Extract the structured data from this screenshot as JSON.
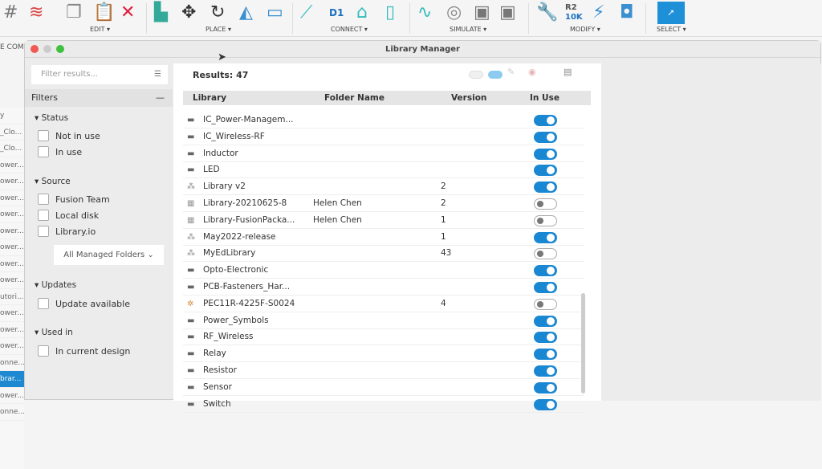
{
  "toolbar": {
    "groups": [
      "EDIT ▾",
      "PLACE ▾",
      "CONNECT ▾",
      "SIMULATE ▾",
      "MODIFY ▾",
      "SELECT ▾"
    ],
    "r2_label": "R2",
    "r2_value": "10K",
    "d1": "D1",
    "comp": "E COMP"
  },
  "background_list": [
    "y",
    "_Clo...",
    "_Clo...",
    "ower...",
    "ower...",
    "ower...",
    "ower...",
    "ower...",
    "ower...",
    "ower...",
    "ower...",
    "utori...",
    "ower...",
    "ower...",
    "ower...",
    "onne...",
    "brar...",
    "ower...",
    "onne..."
  ],
  "dialog": {
    "title": "Library Manager"
  },
  "filters": {
    "search_placeholder": "Filter results...",
    "title": "Filters",
    "collapse": "—",
    "status": "Status",
    "not_in_use": "Not in use",
    "in_use": "In use",
    "source": "Source",
    "fusion_team": "Fusion Team",
    "local_disk": "Local disk",
    "library_io": "Library.io",
    "folders": "All Managed Folders ⌄",
    "updates": "Updates",
    "update_available": "Update available",
    "used_in": "Used in",
    "in_current_design": "In current design"
  },
  "results": {
    "label": "Results: 47"
  },
  "columns": {
    "library": "Library",
    "folder": "Folder Name",
    "version": "Version",
    "in_use": "In Use"
  },
  "rows": [
    {
      "name": "IC_Power-Managem...",
      "folder": "",
      "version": "",
      "on": true,
      "icon": "cloud"
    },
    {
      "name": "IC_Wireless-RF",
      "folder": "",
      "version": "",
      "on": true,
      "icon": "cloud"
    },
    {
      "name": "Inductor",
      "folder": "",
      "version": "",
      "on": true,
      "icon": "cloud"
    },
    {
      "name": "LED",
      "folder": "",
      "version": "",
      "on": true,
      "icon": "cloud"
    },
    {
      "name": "Library v2",
      "folder": "",
      "version": "2",
      "on": true,
      "icon": "team"
    },
    {
      "name": "Library-20210625-8",
      "folder": "Helen Chen",
      "version": "2",
      "on": false,
      "icon": "grid"
    },
    {
      "name": "Library-FusionPacka...",
      "folder": "Helen Chen",
      "version": "1",
      "on": false,
      "icon": "grid"
    },
    {
      "name": "May2022-release",
      "folder": "",
      "version": "1",
      "on": true,
      "icon": "team"
    },
    {
      "name": "MyEdLibrary",
      "folder": "",
      "version": "43",
      "on": false,
      "icon": "team"
    },
    {
      "name": "Opto-Electronic",
      "folder": "",
      "version": "",
      "on": true,
      "icon": "cloud"
    },
    {
      "name": "PCB-Fasteners_Har...",
      "folder": "",
      "version": "",
      "on": true,
      "icon": "cloud"
    },
    {
      "name": "PEC11R-4225F-S0024",
      "folder": "",
      "version": "4",
      "on": false,
      "icon": "pkg"
    },
    {
      "name": "Power_Symbols",
      "folder": "",
      "version": "",
      "on": true,
      "icon": "cloud"
    },
    {
      "name": "RF_Wireless",
      "folder": "",
      "version": "",
      "on": true,
      "icon": "cloud"
    },
    {
      "name": "Relay",
      "folder": "",
      "version": "",
      "on": true,
      "icon": "cloud"
    },
    {
      "name": "Resistor",
      "folder": "",
      "version": "",
      "on": true,
      "icon": "cloud"
    },
    {
      "name": "Sensor",
      "folder": "",
      "version": "",
      "on": true,
      "icon": "cloud"
    },
    {
      "name": "Switch",
      "folder": "",
      "version": "",
      "on": true,
      "icon": "cloud"
    }
  ]
}
